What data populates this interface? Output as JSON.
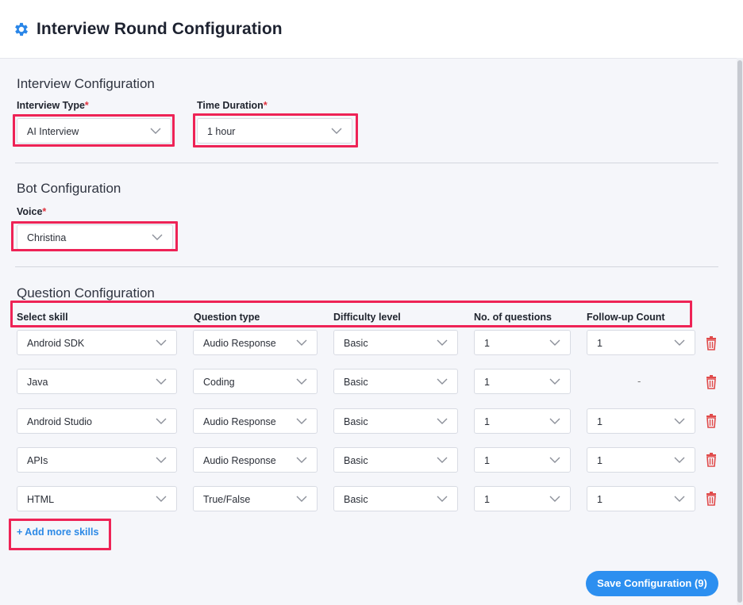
{
  "header": {
    "title": "Interview Round Configuration",
    "icon": "gear-icon"
  },
  "interview_config": {
    "title": "Interview Configuration",
    "interview_type": {
      "label": "Interview Type",
      "value": "AI Interview"
    },
    "time_duration": {
      "label": "Time Duration",
      "value": "1 hour"
    }
  },
  "bot_config": {
    "title": "Bot Configuration",
    "voice": {
      "label": "Voice",
      "value": "Christina"
    }
  },
  "question_config": {
    "title": "Question Configuration",
    "columns": {
      "skill": "Select skill",
      "qtype": "Question type",
      "difficulty": "Difficulty level",
      "count": "No. of questions",
      "followup": "Follow-up Count"
    },
    "rows": [
      {
        "skill": "Android SDK",
        "qtype": "Audio Response",
        "difficulty": "Basic",
        "count": "1",
        "followup": "1"
      },
      {
        "skill": "Java",
        "qtype": "Coding",
        "difficulty": "Basic",
        "count": "1",
        "followup": "-"
      },
      {
        "skill": "Android Studio",
        "qtype": "Audio Response",
        "difficulty": "Basic",
        "count": "1",
        "followup": "1"
      },
      {
        "skill": "APIs",
        "qtype": "Audio Response",
        "difficulty": "Basic",
        "count": "1",
        "followup": "1"
      },
      {
        "skill": "HTML",
        "qtype": "True/False",
        "difficulty": "Basic",
        "count": "1",
        "followup": "1"
      }
    ],
    "add_more": "+ Add more skills"
  },
  "save_button": "Save Configuration (9)",
  "required_mark": "*",
  "colors": {
    "accent": "#2c8ff0",
    "highlight": "#ee2356",
    "required": "#e0333f",
    "delete": "#e04a4a"
  }
}
